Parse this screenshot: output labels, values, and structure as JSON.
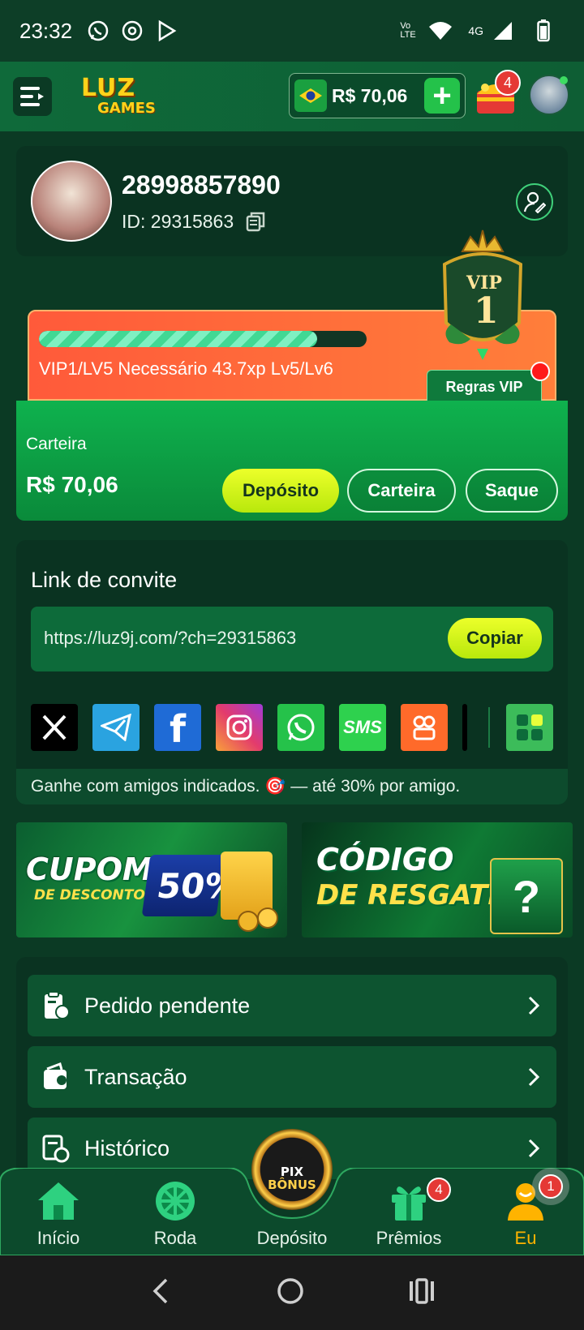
{
  "status_bar": {
    "time": "23:32",
    "left_icons": [
      "whatsapp-icon",
      "chrome-icon",
      "play-store-icon"
    ],
    "right_icons": [
      "volte-icon",
      "wifi-icon",
      "signal-4g-icon",
      "battery-icon"
    ],
    "volte": "Vo LTE",
    "network": "4G"
  },
  "header": {
    "logo_line1": "LUZ",
    "logo_line2": "GAMES",
    "balance": "R$ 70,06",
    "gift_badge": "4"
  },
  "profile": {
    "username": "28998857890",
    "id_text": "ID: 29315863"
  },
  "vip": {
    "progress": 0.85,
    "status_text": "VIP1/LV5  Necessário 43.7xp Lv5/Lv6",
    "rules_label": "Regras VIP",
    "badge_text": "VIP",
    "badge_level": "1"
  },
  "wallet": {
    "label": "Carteira",
    "amount": "R$ 70,06",
    "deposit_label": "Depósito",
    "wallet_label": "Carteira",
    "withdraw_label": "Saque"
  },
  "invite": {
    "title": "Link de convite",
    "link": "https://luz9j.com/?ch=29315863",
    "copy_label": "Copiar",
    "share_icons": [
      "x-icon",
      "telegram-icon",
      "facebook-icon",
      "instagram-icon",
      "whatsapp-icon",
      "sms-icon",
      "kwai-icon",
      "tiktok-icon",
      "more-apps-icon"
    ],
    "sms_label": "SMS",
    "note": "Ganhe com amigos indicados. 🎯 — até 30% por amigo."
  },
  "banners": {
    "coupon_title": "CUPOM",
    "coupon_sub": "DE DESCONTO",
    "coupon_pct": "50%",
    "code_title": "CÓDIGO",
    "code_sub": "DE RESGATE",
    "code_mark": "?"
  },
  "menu": {
    "items": [
      {
        "label": "Pedido pendente",
        "icon": "pending-order-icon"
      },
      {
        "label": "Transação",
        "icon": "wallet-transaction-icon"
      },
      {
        "label": "Histórico",
        "icon": "history-icon"
      }
    ]
  },
  "bottom_nav": {
    "items": [
      {
        "label": "Início",
        "icon": "home-icon"
      },
      {
        "label": "Roda",
        "icon": "wheel-icon"
      },
      {
        "label": "Depósito",
        "icon": "pix-bonus-icon"
      },
      {
        "label": "Prêmios",
        "icon": "gift-icon"
      },
      {
        "label": "Eu",
        "icon": "user-icon"
      }
    ],
    "pix_label_1": "PIX",
    "pix_label_2": "BÔNUS",
    "premios_badge": "4",
    "eu_badge": "1"
  },
  "colors": {
    "accent_green": "#0fb24e",
    "deposit_yellow": "#ecff2a",
    "vip_orange": "#ff5a3a",
    "active_nav": "#ffb300"
  }
}
